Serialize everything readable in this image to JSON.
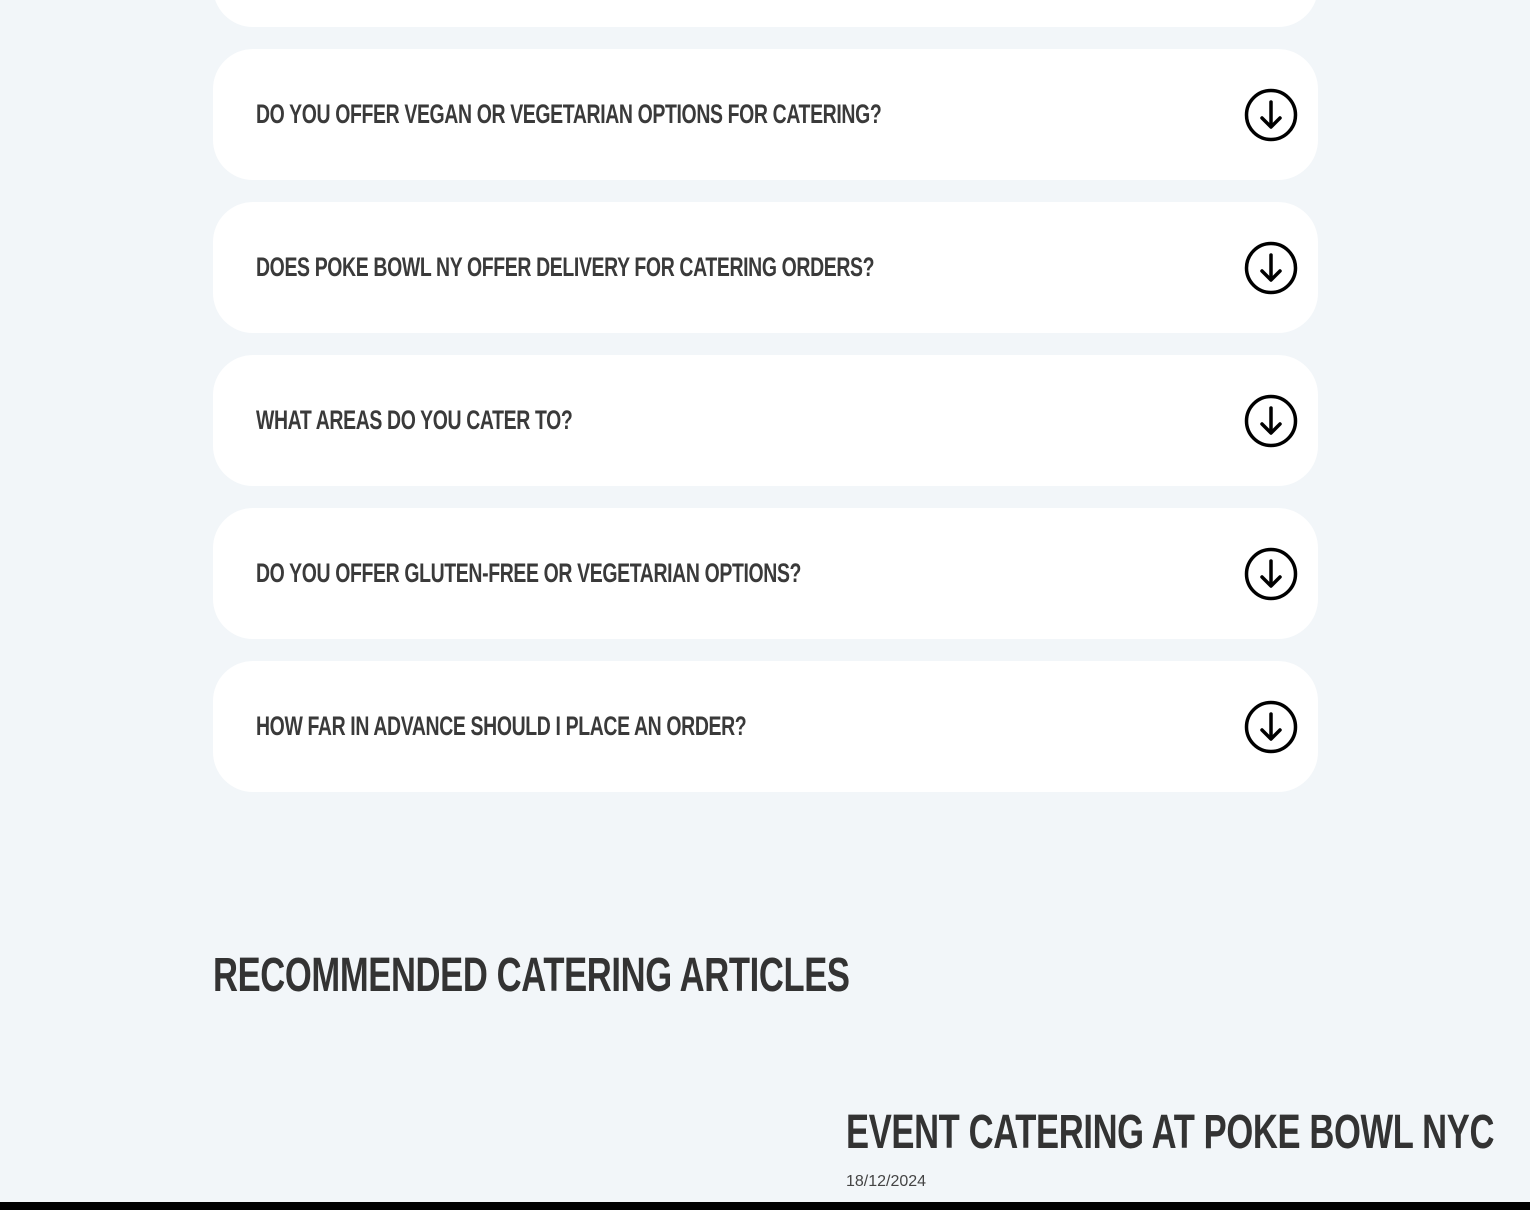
{
  "faq": {
    "items": [
      {
        "question": ""
      },
      {
        "question": "Do you offer vegan or vegetarian options for catering?"
      },
      {
        "question": "Does Poke Bowl NY offer delivery for catering orders?"
      },
      {
        "question": "What areas do you cater to?"
      },
      {
        "question": "Do you offer gluten-free or vegetarian options?"
      },
      {
        "question": "How far in advance should I place an order?"
      }
    ],
    "toggle_icon": "arrow-down-circle-icon"
  },
  "articles": {
    "section_title": "Recommended Catering Articles",
    "items": [
      {
        "title": "Event Catering at Poke Bowl NYC",
        "date": "18/12/2024"
      }
    ]
  },
  "colors": {
    "background": "#f2f6f9",
    "card": "#ffffff",
    "heading_text": "#333333",
    "icon": "#000000"
  }
}
